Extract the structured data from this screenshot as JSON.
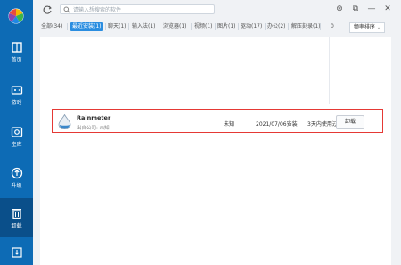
{
  "sidebar": {
    "items": [
      {
        "label": "首页",
        "icon": "home-icon"
      },
      {
        "label": "游戏",
        "icon": "gamepad-icon"
      },
      {
        "label": "宝库",
        "icon": "treasure-icon"
      },
      {
        "label": "升级",
        "icon": "upgrade-icon"
      },
      {
        "label": "卸载",
        "icon": "trash-icon"
      }
    ],
    "active_index": 4
  },
  "search": {
    "placeholder": "请输入想搜索的软件"
  },
  "tabs": [
    {
      "label": "全部(34)"
    },
    {
      "label": "最近安装(1)"
    },
    {
      "label": "聊天(1)"
    },
    {
      "label": "输入法(1)"
    },
    {
      "label": "浏览器(1)"
    },
    {
      "label": "视频(1)"
    },
    {
      "label": "图片(1)"
    },
    {
      "label": "驱动(17)"
    },
    {
      "label": "办公(2)"
    },
    {
      "label": "解压刻录(1)"
    },
    {
      "label": "0"
    }
  ],
  "sort": {
    "label": "频率排序"
  },
  "app": {
    "name": "Rainmeter",
    "publisher": "出自公司: 未知",
    "size": "未知",
    "install_date": "2021/07/06安装",
    "last_used": "3天内使用过",
    "uninstall_label": "卸载"
  },
  "colors": {
    "sidebar": "#0d6bb5",
    "accent": "#2a8de0",
    "highlight_border": "#e53935"
  }
}
